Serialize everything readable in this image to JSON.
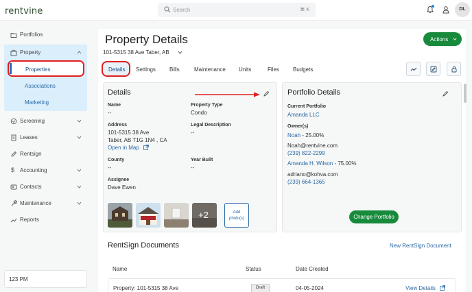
{
  "brand": {
    "logo": "rentvine",
    "accent": "#178a3b",
    "link_color": "#2a6aa5",
    "highlight": "#e02020"
  },
  "search": {
    "placeholder": "Search",
    "shortcut": "⌘ K"
  },
  "user": {
    "initials": "DL"
  },
  "sidebar": {
    "items": [
      {
        "label": "Portfolios",
        "icon": "folder-icon"
      },
      {
        "label": "Property",
        "icon": "building-icon"
      },
      {
        "label": "Screening",
        "icon": "screening-icon"
      },
      {
        "label": "Leases",
        "icon": "document-icon"
      },
      {
        "label": "Rentsign",
        "icon": "pen-icon"
      },
      {
        "label": "Accounting",
        "icon": "dollar-icon"
      },
      {
        "label": "Contacts",
        "icon": "contacts-icon"
      },
      {
        "label": "Maintenance",
        "icon": "wrench-icon"
      },
      {
        "label": "Reports",
        "icon": "chart-icon"
      }
    ],
    "property_subitems": [
      "Properties",
      "Associations",
      "Marketing"
    ],
    "footer_text": "123 PM"
  },
  "page": {
    "title": "Property Details",
    "address": "101-5315 38 Ave Taber, AB",
    "actions_label": "Actions"
  },
  "tabs": [
    "Details",
    "Settings",
    "Bills",
    "Maintenance",
    "Units",
    "Files",
    "Budgets"
  ],
  "details": {
    "title": "Details",
    "name_label": "Name",
    "name_value": "--",
    "type_label": "Property Type",
    "type_value": "Condo",
    "address_label": "Address",
    "address_line1": "101-5315 38 Ave",
    "address_line2": "Taber, AB T1G 1N4 , CA",
    "map_link": "Open in Map",
    "legal_label": "Legal Description",
    "legal_value": "--",
    "county_label": "County",
    "county_value": "--",
    "year_label": "Year Built",
    "year_value": "--",
    "assignee_label": "Assignee",
    "assignee_value": "Dave Ewen",
    "more_photos": "+2",
    "add_photos_line1": "Add",
    "add_photos_line2": "photo(s)"
  },
  "portfolio": {
    "title": "Portfolio Details",
    "current_label": "Current Portfolio",
    "current_value": "Amanda LLC",
    "owners_label": "Owner(s)",
    "owners": [
      {
        "name": "Noah",
        "share": " - 25.00%",
        "email": "Noah@rentvine.com",
        "phone": "(239) 822-2299"
      },
      {
        "name": "Amanda H. Wilson",
        "share": " - 75.00%",
        "email": "adriano@kohva.com",
        "phone": "(239) 664-1365"
      }
    ],
    "change_button": "Change Portfolio"
  },
  "rentsign": {
    "title": "RentSign Documents",
    "new_link": "New RentSign Document",
    "columns": [
      "Name",
      "Status",
      "Date Created"
    ],
    "rows": [
      {
        "name": "Property: 101-5315 38 Ave",
        "status": "Draft",
        "date": "04-05-2024",
        "action": "View Details"
      }
    ]
  }
}
